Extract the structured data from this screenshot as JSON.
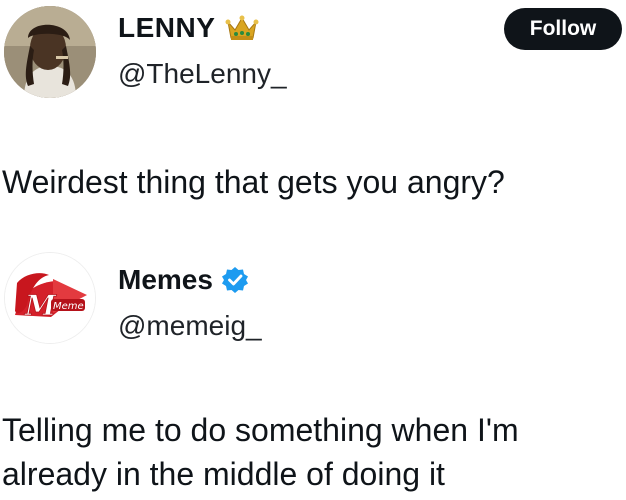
{
  "posts": [
    {
      "author": {
        "display_name": "LENNY",
        "handle": "@TheLenny_",
        "badge_icon": "crown-icon"
      },
      "follow_label": "Follow",
      "text": "Weirdest thing that gets you angry?"
    },
    {
      "author": {
        "display_name": "Memes",
        "handle": "@memeig_",
        "badge_icon": "verified-badge-icon",
        "avatar_logo_text": "Meme"
      },
      "text": "Telling me to do something when I'm already in the middle of doing it"
    }
  ],
  "colors": {
    "text": "#0f1419",
    "follow_button_bg": "#0f1419",
    "verified_blue": "#1d9bf0",
    "crown_gold": "#d9a521",
    "meme_logo_red": "#d4202a"
  }
}
